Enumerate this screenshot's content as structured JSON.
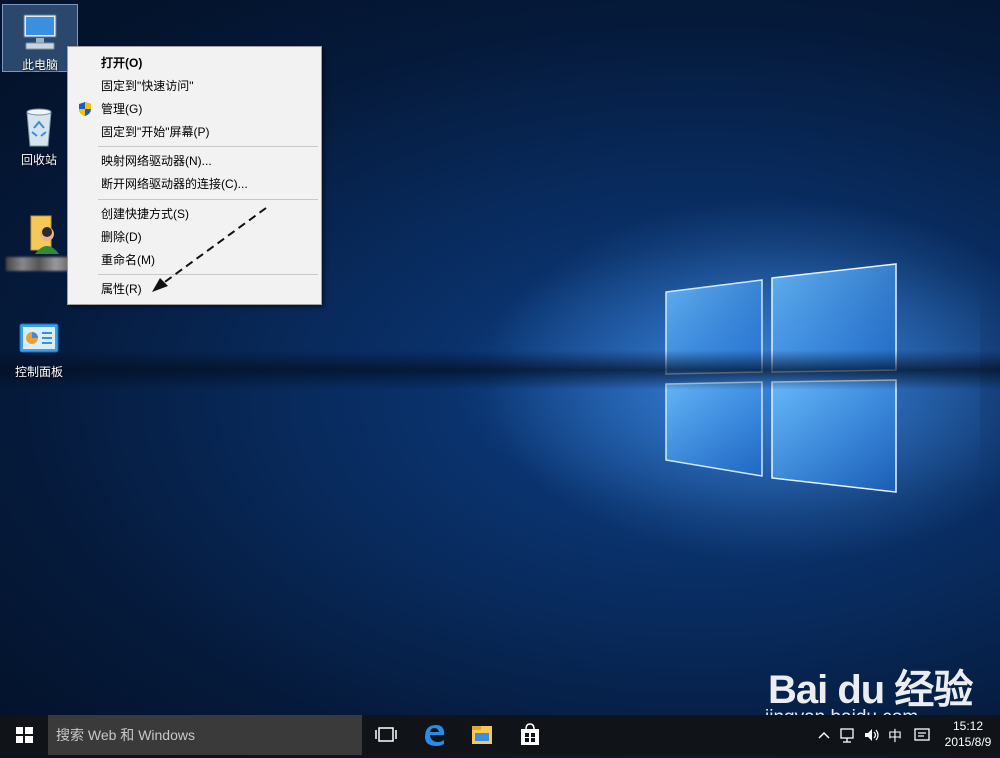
{
  "desktop": {
    "icons": [
      {
        "label": "此电脑",
        "icon": "computer-icon"
      },
      {
        "label": "回收站",
        "icon": "recycle-bin-icon"
      },
      {
        "label": "",
        "icon": "user-folder-icon"
      },
      {
        "label": "控制面板",
        "icon": "control-panel-icon"
      }
    ]
  },
  "context_menu": {
    "items": [
      {
        "label": "打开(O)"
      },
      {
        "label": "固定到\"快速访问\""
      },
      {
        "label": "管理(G)",
        "icon": "shield-icon"
      },
      {
        "label": "固定到\"开始\"屏幕(P)"
      },
      {
        "label": "映射网络驱动器(N)..."
      },
      {
        "label": "断开网络驱动器的连接(C)..."
      },
      {
        "label": "创建快捷方式(S)"
      },
      {
        "label": "删除(D)"
      },
      {
        "label": "重命名(M)"
      },
      {
        "label": "属性(R)"
      }
    ]
  },
  "taskbar": {
    "search_placeholder": "搜索 Web 和 Windows",
    "ime": "中",
    "time": "15:12",
    "date": "2015/8/9"
  },
  "watermark": {
    "brand": "Bai du 经验",
    "url": "jingyan.baidu.com"
  },
  "colors": {
    "desktop_dark": "#04132c",
    "desktop_light": "#5aaaff",
    "menu_bg": "#f2f2f2",
    "taskbar": "#101317",
    "search_bg": "#3a3a3a"
  }
}
